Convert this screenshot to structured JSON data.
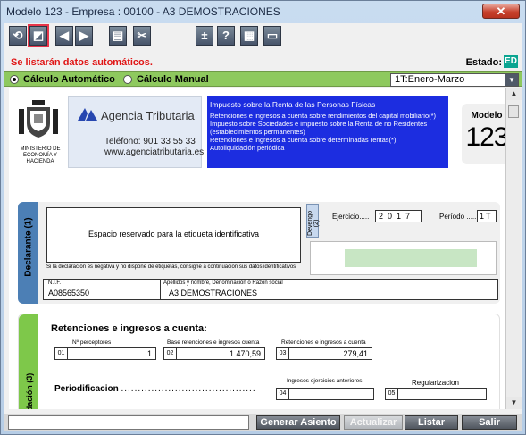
{
  "window": {
    "title": "Modelo 123 - Empresa : 00100 - A3 DEMOSTRACIONES",
    "close_label": "✕"
  },
  "toolbar": {
    "buttons": [
      "refresh-icon",
      "edit-icon",
      "prev-icon",
      "next-icon",
      "print-icon",
      "tools-icon",
      "plusminus-icon",
      "help-icon",
      "calculator-icon",
      "save-icon"
    ]
  },
  "info": {
    "warning": "Se listarán datos automáticos.",
    "estado_label": "Estado:",
    "estado_value": "ED"
  },
  "calc": {
    "auto_label": "Cálculo Automático",
    "manual_label": "Cálculo Manual",
    "auto_selected": true,
    "period_value": "1T:Enero-Marzo"
  },
  "header": {
    "ministerio": "MINISTERIO DE ECONOMÍA Y HACIENDA",
    "agencia_name": "Agencia Tributaria",
    "telefono": "Teléfono: 901 33 55 33",
    "web": "www.agenciatributaria.es",
    "blue_title": "Impuesto sobre la Renta de las Personas Físicas",
    "blue_lines": [
      "Retenciones e ingresos a cuenta sobre rendimientos del capital mobiliario(*)",
      "Impuesto sobre Sociedades e impuesto sobre la Renta de no Residentes (establecimientos permanentes)",
      "Retenciones e ingresos a cuenta sobre determinadas rentas(*)",
      "Autoliquidación periódica"
    ],
    "modelo_label": "Modelo",
    "modelo_number": "123"
  },
  "declarante": {
    "side_label": "Declarante (1)",
    "etiqueta": "Espacio reservado para la etiqueta identificativa",
    "etiqueta_note": "Si la declaración es negativa y no dispone de etiquetas, consigne a continuación sus datos identificativos",
    "devengo": "Devengo (2)",
    "ejercicio_label": "Ejercicio.....",
    "ejercicio_value": "2017",
    "periodo_label": "Período .....",
    "periodo_value": "1T",
    "nif_label": "N.I.F.",
    "nif_value": "A08565350",
    "apellidos_label": "Apellidos y nombre, Denominación o Razón social",
    "apellidos_value": "A3 DEMOSTRACIONES"
  },
  "liquidacion": {
    "side_label": "dación (3)",
    "title": "Retenciones e ingresos a cuenta:",
    "perceptores_label": "Nº perceptores",
    "base_label": "Base retenciones e ingresos cuenta",
    "retenciones_label": "Retenciones e ingresos a  cuenta",
    "f01_num": "01",
    "f01_value": "1",
    "f02_num": "02",
    "f02_value": "1.470,59",
    "f03_num": "03",
    "f03_value": "279,41",
    "periodificacion": "Periodificacion",
    "dots": "........................................",
    "ingresos_ant_label": "Ingresos ejercicios anteriores",
    "regularizacion_label": "Regularizacion",
    "f04_num": "04",
    "f05_num": "05"
  },
  "footer": {
    "generar": "Generar Asiento",
    "actualizar": "Actualizar",
    "listar": "Listar",
    "salir": "Salir"
  }
}
